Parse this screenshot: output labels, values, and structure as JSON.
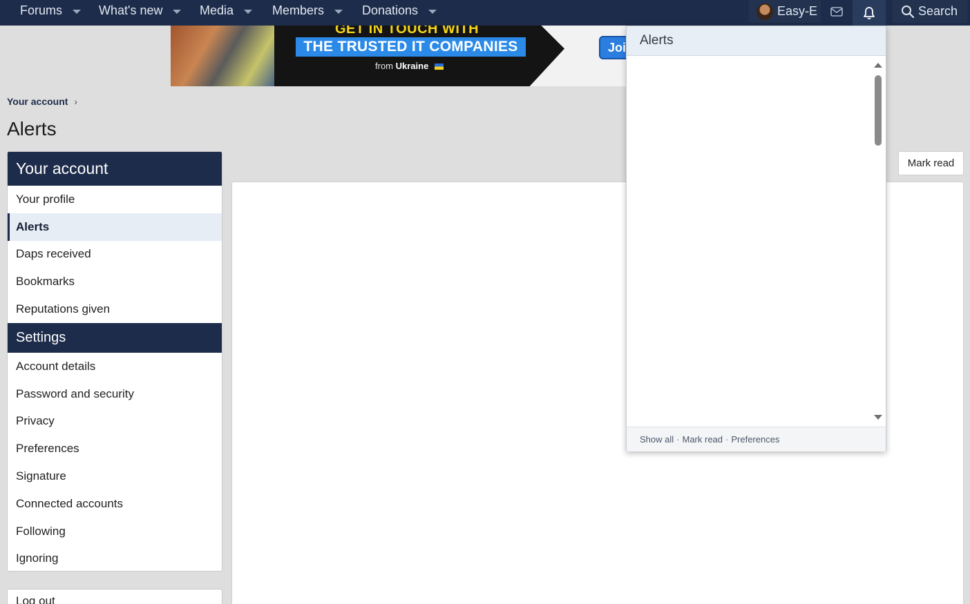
{
  "nav": {
    "items": [
      {
        "label": "Forums"
      },
      {
        "label": "What's new"
      },
      {
        "label": "Media"
      },
      {
        "label": "Members"
      },
      {
        "label": "Donations"
      }
    ],
    "username": "Easy-E",
    "search_label": "Search"
  },
  "banner": {
    "line1": "GET IN TOUCH WITH",
    "line2": "THE TRUSTED IT COMPANIES",
    "line3_prefix": "from",
    "line3_bold": "Ukraine",
    "cta": "Joi"
  },
  "breadcrumb": {
    "label": "Your account"
  },
  "page": {
    "title": "Alerts"
  },
  "sidebar": {
    "account_heading": "Your account",
    "account_items": [
      {
        "label": "Your profile"
      },
      {
        "label": "Alerts"
      },
      {
        "label": "Daps received"
      },
      {
        "label": "Bookmarks"
      },
      {
        "label": "Reputations given"
      }
    ],
    "settings_heading": "Settings",
    "settings_items": [
      {
        "label": "Account details"
      },
      {
        "label": "Password and security"
      },
      {
        "label": "Privacy"
      },
      {
        "label": "Preferences"
      },
      {
        "label": "Signature"
      },
      {
        "label": "Connected accounts"
      },
      {
        "label": "Following"
      },
      {
        "label": "Ignoring"
      }
    ],
    "logout": "Log out"
  },
  "main": {
    "mark_read": "Mark read"
  },
  "popup": {
    "title": "Alerts",
    "footer": {
      "show_all": "Show all",
      "mark_read": "Mark read",
      "preferences": "Preferences",
      "separator": "·"
    }
  },
  "colors": {
    "nav_bg": "#1d2c4a",
    "page_bg": "#dedede",
    "active_item_bg": "#e6edf5"
  }
}
